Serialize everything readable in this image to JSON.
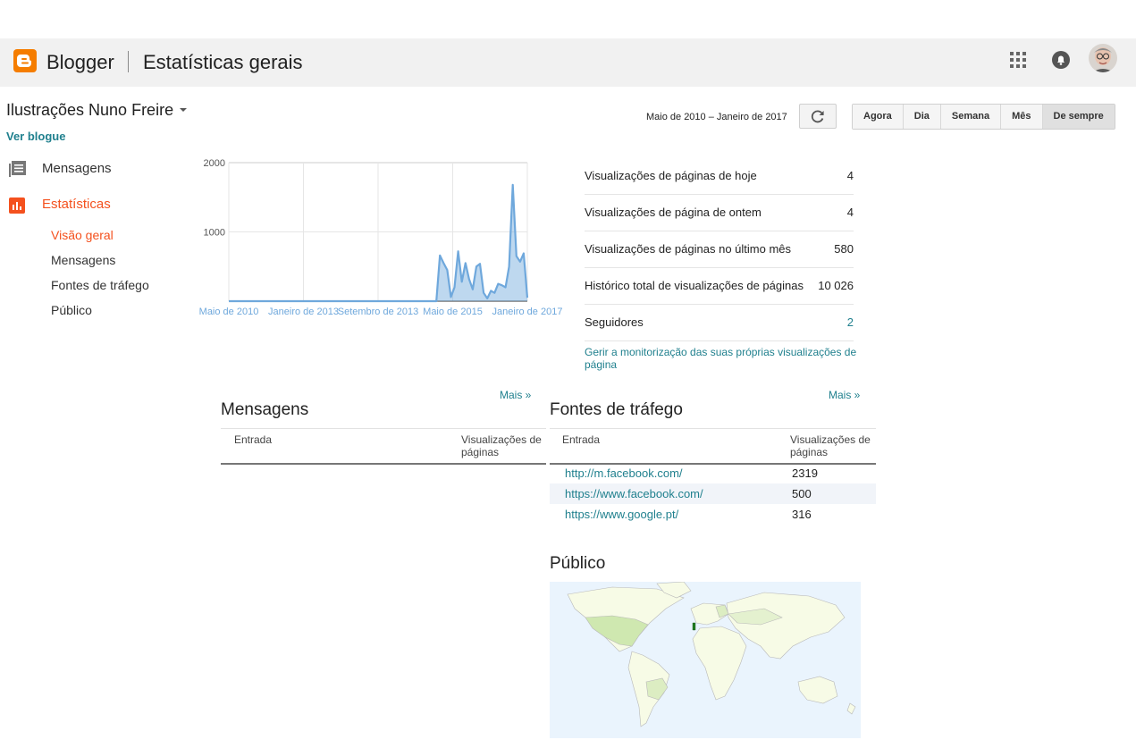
{
  "header": {
    "app_name": "Blogger",
    "page_title": "Estatísticas gerais"
  },
  "sidebar": {
    "blog_title": "Ilustrações Nuno Freire",
    "view_blog": "Ver blogue",
    "nav": [
      {
        "label": "Mensagens",
        "icon": "posts-icon"
      },
      {
        "label": "Estatísticas",
        "icon": "stats-icon",
        "active": true
      }
    ],
    "sub_nav": [
      {
        "label": "Visão geral",
        "active": true
      },
      {
        "label": "Mensagens"
      },
      {
        "label": "Fontes de tráfego"
      },
      {
        "label": "Público"
      }
    ]
  },
  "range": {
    "label": "Maio de 2010 – Janeiro de 2017",
    "buttons": [
      "Agora",
      "Dia",
      "Semana",
      "Mês",
      "De sempre"
    ],
    "active": "De sempre"
  },
  "chart_data": {
    "type": "area",
    "y_ticks": [
      "2000",
      "1000"
    ],
    "ylim": [
      0,
      2000
    ],
    "x_tick_labels": [
      "Maio de 2010",
      "Janeiro de 2013",
      "Setembro de 2013",
      "Maio de 2015",
      "Janeiro de 2017"
    ],
    "series_color": "#6fa8dc",
    "values": [
      0,
      0,
      0,
      0,
      0,
      0,
      0,
      0,
      0,
      0,
      0,
      0,
      0,
      0,
      0,
      0,
      0,
      0,
      0,
      0,
      0,
      0,
      0,
      0,
      0,
      0,
      0,
      0,
      0,
      0,
      0,
      0,
      0,
      0,
      0,
      0,
      0,
      0,
      0,
      0,
      0,
      0,
      0,
      0,
      0,
      0,
      0,
      0,
      0,
      0,
      0,
      0,
      0,
      0,
      0,
      0,
      0,
      0,
      660,
      550,
      450,
      60,
      200,
      720,
      280,
      550,
      320,
      170,
      500,
      540,
      120,
      40,
      150,
      120,
      250,
      230,
      200,
      500,
      1680,
      650,
      570,
      690,
      50
    ]
  },
  "summary": {
    "rows": [
      {
        "label": "Visualizações de páginas de hoje",
        "value": "4"
      },
      {
        "label": "Visualizações de página de ontem",
        "value": "4"
      },
      {
        "label": "Visualizações de páginas no último mês",
        "value": "580"
      },
      {
        "label": "Histórico total de visualizações de páginas",
        "value": "10 026"
      },
      {
        "label": "Seguidores",
        "value": "2"
      }
    ],
    "manage_link": "Gerir a monitorização das suas próprias visualizações de página"
  },
  "posts": {
    "title": "Mensagens",
    "more": "Mais »",
    "col_entry": "Entrada",
    "col_views": "Visualizações de páginas"
  },
  "traffic": {
    "title": "Fontes de tráfego",
    "more": "Mais »",
    "col_entry": "Entrada",
    "col_views": "Visualizações de páginas",
    "rows": [
      {
        "source": "http://m.facebook.com/",
        "views": "2319"
      },
      {
        "source": "https://www.facebook.com/",
        "views": "500"
      },
      {
        "source": "https://www.google.pt/",
        "views": "316"
      }
    ]
  },
  "audience": {
    "title": "Público"
  },
  "colors": {
    "brand": "#f57d00",
    "accent": "#f4511e",
    "link": "#20808e"
  }
}
